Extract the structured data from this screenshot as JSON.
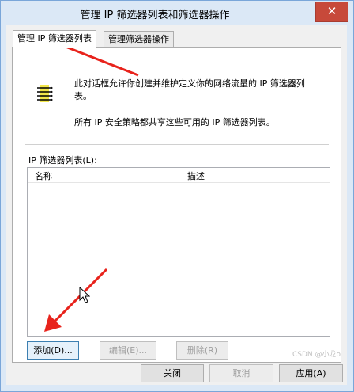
{
  "window": {
    "title": "管理 IP 筛选器列表和筛选器操作",
    "close_glyph": "✕"
  },
  "tabs": [
    {
      "label": "管理 IP 筛选器列表",
      "active": true
    },
    {
      "label": "管理筛选器操作",
      "active": false
    }
  ],
  "panel": {
    "description": "此对话框允许你创建并维护定义你的网络流量的 IP 筛选器列表。",
    "shared_note": "所有 IP 安全策略都共享这些可用的 IP 筛选器列表。",
    "list_label": "IP 筛选器列表(L):",
    "columns": [
      "名称",
      "描述"
    ],
    "rows": []
  },
  "buttons": {
    "add": "添加(D)...",
    "edit": "编辑(E)...",
    "delete": "删除(R)"
  },
  "footer": {
    "close": "关闭",
    "cancel": "取消",
    "apply": "应用(A)"
  },
  "watermark": "CSDN @小龙o",
  "colors": {
    "accent": "#3c7fb1",
    "annotation_arrow": "#e8231c",
    "close_button": "#c7493a"
  }
}
